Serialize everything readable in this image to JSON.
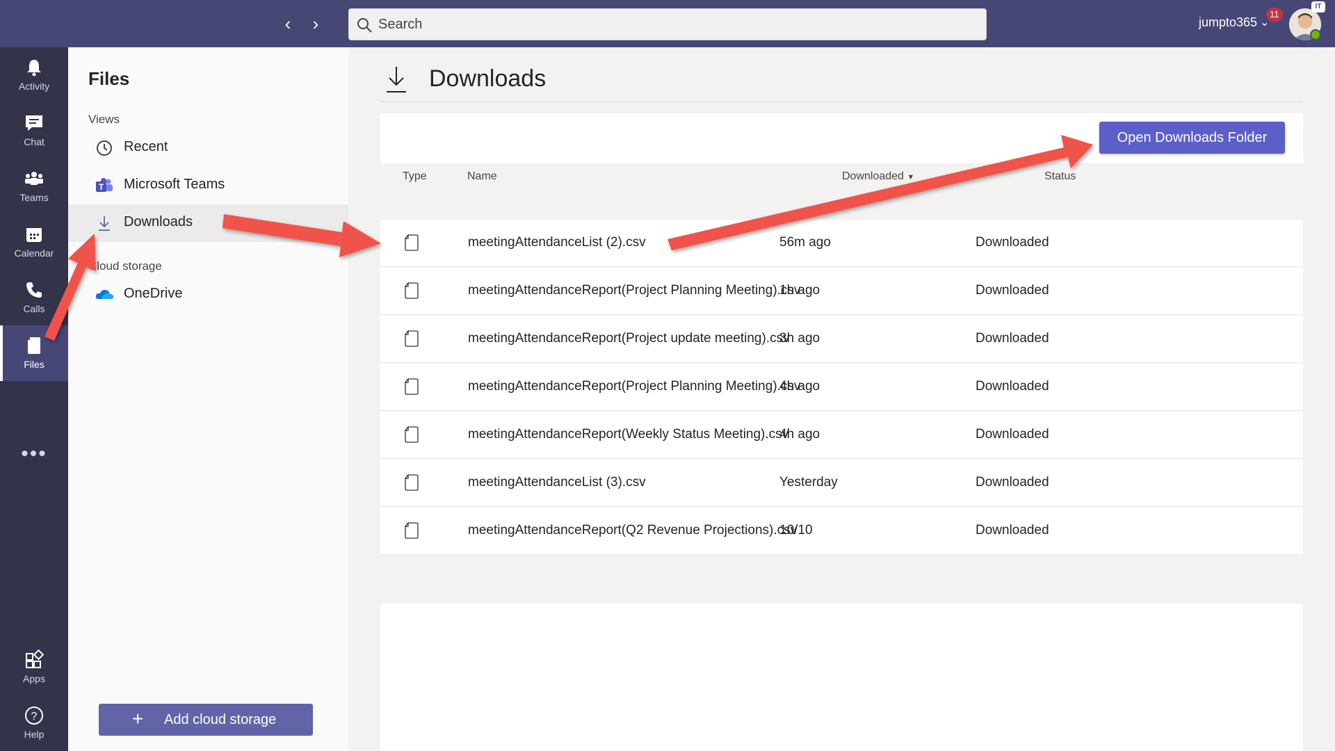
{
  "search": {
    "placeholder": "Search"
  },
  "user": {
    "name": "jumpto365",
    "notifications": "11",
    "tenant_badge": "IT"
  },
  "rail": [
    {
      "label": "Activity",
      "icon": "bell-icon"
    },
    {
      "label": "Chat",
      "icon": "chat-icon"
    },
    {
      "label": "Teams",
      "icon": "teams-icon"
    },
    {
      "label": "Calendar",
      "icon": "calendar-icon"
    },
    {
      "label": "Calls",
      "icon": "phone-icon"
    },
    {
      "label": "Files",
      "icon": "file-icon",
      "active": true
    }
  ],
  "rail_bottom": [
    {
      "label": "Apps",
      "icon": "apps-icon"
    },
    {
      "label": "Help",
      "icon": "help-icon"
    }
  ],
  "panel": {
    "title": "Files",
    "views_label": "Views",
    "views": [
      {
        "label": "Recent",
        "icon": "clock-icon"
      },
      {
        "label": "Microsoft Teams",
        "icon": "microsoft-teams-icon"
      },
      {
        "label": "Downloads",
        "icon": "download-icon",
        "selected": true
      }
    ],
    "cloud_label": "Cloud storage",
    "cloud": [
      {
        "label": "OneDrive",
        "icon": "onedrive-icon"
      }
    ],
    "add_cloud_label": "Add cloud storage"
  },
  "main": {
    "title": "Downloads",
    "open_folder_label": "Open Downloads Folder",
    "columns": {
      "type": "Type",
      "name": "Name",
      "modified": "Downloaded",
      "status": "Status"
    },
    "files": [
      {
        "name": "meetingAttendanceList (2).csv",
        "modified": "56m ago",
        "status": "Downloaded"
      },
      {
        "name": "meetingAttendanceReport(Project Planning Meeting).csv",
        "modified": "1h ago",
        "status": "Downloaded"
      },
      {
        "name": "meetingAttendanceReport(Project update meeting).csv",
        "modified": "3h ago",
        "status": "Downloaded"
      },
      {
        "name": "meetingAttendanceReport(Project Planning Meeting).csv",
        "modified": "4h ago",
        "status": "Downloaded"
      },
      {
        "name": "meetingAttendanceReport(Weekly Status Meeting).csv",
        "modified": "4h ago",
        "status": "Downloaded"
      },
      {
        "name": "meetingAttendanceList (3).csv",
        "modified": "Yesterday",
        "status": "Downloaded"
      },
      {
        "name": "meetingAttendanceReport(Q2 Revenue Projections).csv",
        "modified": "10/10",
        "status": "Downloaded"
      }
    ]
  },
  "colors": {
    "topbar": "#464775",
    "rail": "#33344a",
    "accent": "#5b5fc7",
    "arrow": "#f0524a"
  }
}
